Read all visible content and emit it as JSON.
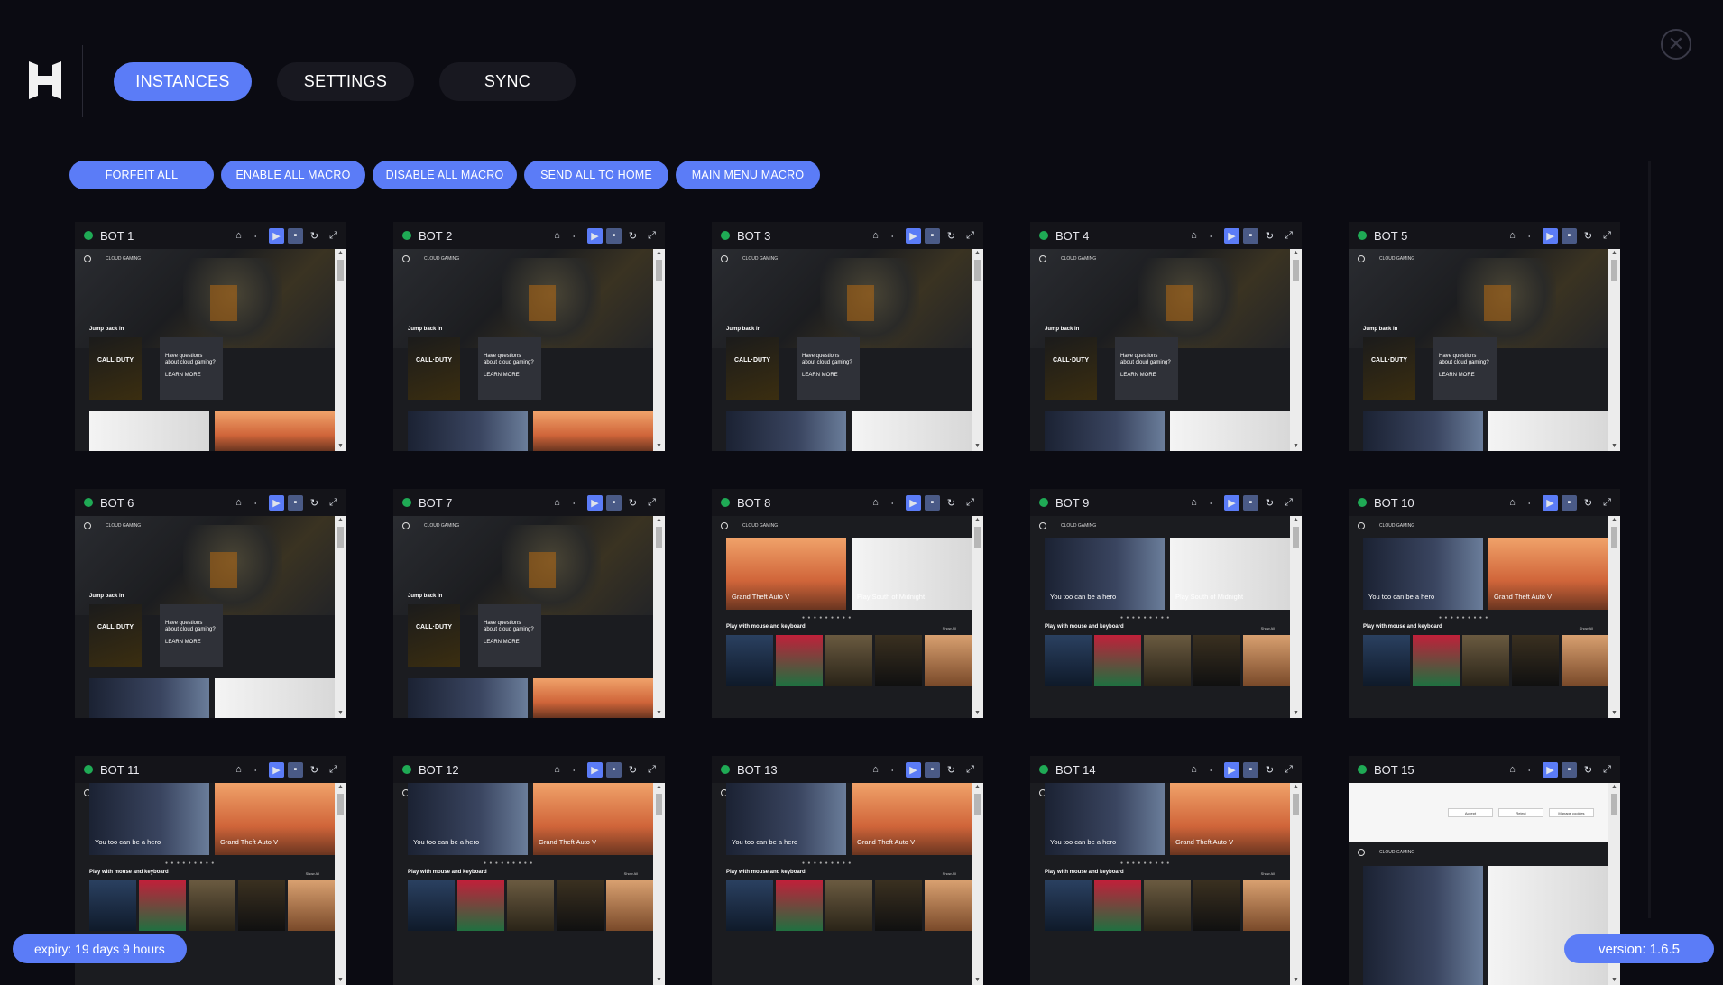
{
  "nav": {
    "tabs": [
      {
        "label": "INSTANCES",
        "active": true
      },
      {
        "label": "SETTINGS",
        "active": false
      },
      {
        "label": "SYNC",
        "active": false
      }
    ]
  },
  "actions": [
    {
      "label": "FORFEIT ALL"
    },
    {
      "label": "ENABLE ALL MACRO"
    },
    {
      "label": "DISABLE ALL MACRO"
    },
    {
      "label": "SEND ALL TO HOME"
    },
    {
      "label": "MAIN MENU MACRO"
    }
  ],
  "bots": [
    {
      "name": "BOT 1",
      "view": "home-jump",
      "strip": [
        "white",
        "gta"
      ]
    },
    {
      "name": "BOT 2",
      "view": "home-jump",
      "strip": [
        "cod",
        "gta"
      ]
    },
    {
      "name": "BOT 3",
      "view": "home-jump",
      "strip": [
        "cod",
        "white"
      ]
    },
    {
      "name": "BOT 4",
      "view": "home-jump",
      "strip": [
        "cod",
        "white"
      ]
    },
    {
      "name": "BOT 5",
      "view": "home-jump",
      "strip": [
        "cod",
        "white"
      ]
    },
    {
      "name": "BOT 6",
      "view": "home-jump",
      "strip": [
        "cod",
        "white"
      ]
    },
    {
      "name": "BOT 7",
      "view": "home-jump",
      "strip": [
        "cod",
        "gta"
      ]
    },
    {
      "name": "BOT 8",
      "view": "featured",
      "features": [
        "Grand Theft Auto V",
        "Play South of Midnight"
      ]
    },
    {
      "name": "BOT 9",
      "view": "featured",
      "features": [
        "You too can be a hero",
        "Play South of Midnight"
      ]
    },
    {
      "name": "BOT 10",
      "view": "featured",
      "features": [
        "You too can be a hero",
        "Grand Theft Auto V"
      ]
    },
    {
      "name": "BOT 11",
      "view": "featured-top",
      "features": [
        "You too can be a hero",
        "Grand Theft Auto V"
      ]
    },
    {
      "name": "BOT 12",
      "view": "featured-top",
      "features": [
        "You too can be a hero",
        "Grand Theft Auto V"
      ]
    },
    {
      "name": "BOT 13",
      "view": "featured-top",
      "features": [
        "You too can be a hero",
        "Grand Theft Auto V"
      ]
    },
    {
      "name": "BOT 14",
      "view": "featured-top",
      "features": [
        "You too can be a hero",
        "Grand Theft Auto V"
      ]
    },
    {
      "name": "BOT 15",
      "view": "cookie"
    }
  ],
  "screen_text": {
    "cloud_gaming": "CLOUD GAMING",
    "jump_back_in": "Jump back in",
    "cod_title": "CALL·DUTY",
    "faq_text": "Have questions about cloud gaming?",
    "learn_more": "LEARN MORE",
    "play_mouse": "Play with mouse and keyboard",
    "show_all": "Show All",
    "accept": "Accept",
    "reject": "Reject",
    "manage": "Manage cookies"
  },
  "footer": {
    "expiry": "expiry: 19 days 9 hours",
    "version": "version: 1.6.5"
  },
  "colors": {
    "accent": "#5b7cf7",
    "status_online": "#1faa55",
    "background": "#0b0b12"
  }
}
